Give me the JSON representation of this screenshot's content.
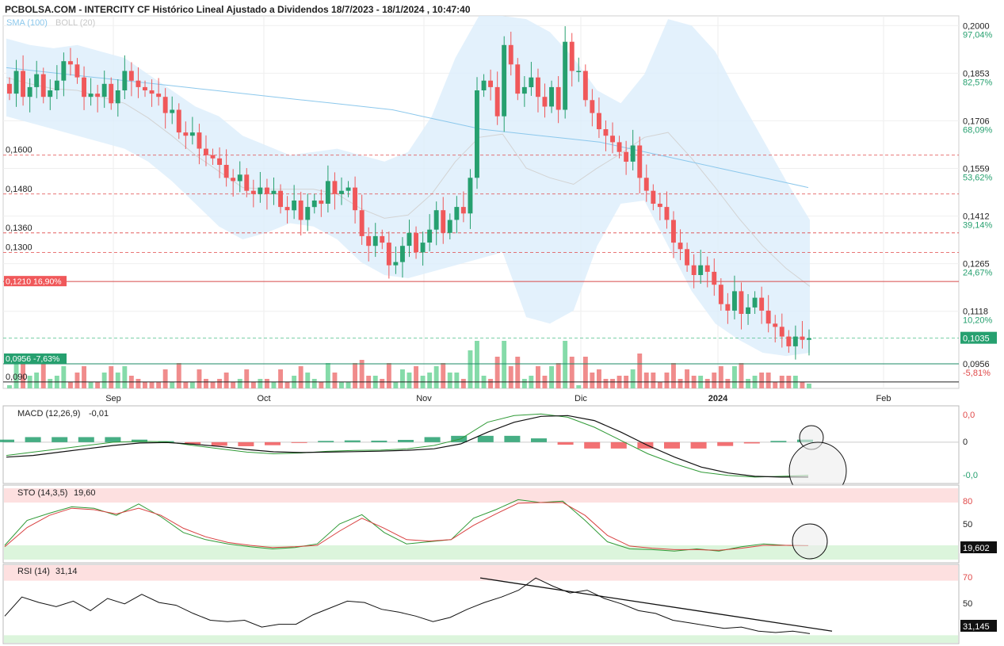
{
  "header": {
    "title": "PCBOLSA.COM - INTERCITY CF Histórico Lineal Ajustado a Dividendos 18/7/2023 - 18/1/2024 , 10:47:40",
    "indicators_sma": "SMA (100)",
    "indicators_boll": "BOLL (20)"
  },
  "colors": {
    "up": "#26a06f",
    "down": "#f0585a",
    "up_vol": "#85dba9",
    "down_vol": "#f08c8c",
    "band_fill": "#dcedfb",
    "sma_line": "#8cc8ec",
    "boll_mid": "#d3d3d3",
    "hline_dash": "#e04848",
    "hline_solid_red": "#d84a4a",
    "hline_green": "#1b8a66",
    "last_price_bg": "#26a06f",
    "red_label_bg": "#f0585a"
  },
  "chart_data": [
    {
      "panel": "price",
      "type": "candlestick",
      "x_tick_labels": [
        "Sep",
        "Oct",
        "Nov",
        "Dic",
        "2024",
        "Feb"
      ],
      "y_ticks": [
        {
          "value": "0,2000",
          "pct": "97,04%"
        },
        {
          "value": "0,1853",
          "pct": "82,57%"
        },
        {
          "value": "0,1706",
          "pct": "68,09%"
        },
        {
          "value": "0,1559",
          "pct": "53,62%"
        },
        {
          "value": "0,1412",
          "pct": "39,14%"
        },
        {
          "value": "0,1265",
          "pct": "24,67%"
        },
        {
          "value": "0,1118",
          "pct": "10,20%"
        },
        {
          "value": "0,0956",
          "pct": "-5,81%"
        }
      ],
      "ylim": [
        0.088,
        0.203
      ],
      "left_labels": [
        {
          "price": 0.16,
          "text": "0,1600"
        },
        {
          "price": 0.148,
          "text": "0,1480"
        },
        {
          "price": 0.136,
          "text": "0,1360"
        },
        {
          "price": 0.13,
          "text": "0,1300"
        },
        {
          "price": 0.09,
          "text": "0,090"
        }
      ],
      "red_label": {
        "price": 0.121,
        "text": "0,1210  16,90%"
      },
      "green_label": {
        "price": 0.0956,
        "text": "0,0956  -7,63%"
      },
      "last_price": {
        "price": 0.1035,
        "text": "0,1035"
      },
      "closes": [
        0.179,
        0.186,
        0.178,
        0.181,
        0.185,
        0.178,
        0.18,
        0.183,
        0.189,
        0.188,
        0.184,
        0.178,
        0.179,
        0.178,
        0.182,
        0.176,
        0.18,
        0.186,
        0.183,
        0.181,
        0.18,
        0.179,
        0.178,
        0.173,
        0.174,
        0.167,
        0.166,
        0.167,
        0.162,
        0.16,
        0.159,
        0.157,
        0.153,
        0.152,
        0.154,
        0.149,
        0.148,
        0.15,
        0.148,
        0.149,
        0.144,
        0.143,
        0.146,
        0.14,
        0.144,
        0.146,
        0.145,
        0.152,
        0.148,
        0.149,
        0.15,
        0.143,
        0.135,
        0.132,
        0.135,
        0.133,
        0.126,
        0.127,
        0.132,
        0.136,
        0.13,
        0.133,
        0.137,
        0.143,
        0.136,
        0.14,
        0.144,
        0.142,
        0.153,
        0.18,
        0.183,
        0.181,
        0.172,
        0.194,
        0.188,
        0.179,
        0.181,
        0.184,
        0.178,
        0.175,
        0.181,
        0.174,
        0.195,
        0.186,
        0.186,
        0.177,
        0.173,
        0.168,
        0.166,
        0.164,
        0.161,
        0.158,
        0.163,
        0.153,
        0.149,
        0.145,
        0.144,
        0.14,
        0.133,
        0.131,
        0.126,
        0.123,
        0.126,
        0.124,
        0.12,
        0.114,
        0.112,
        0.118,
        0.111,
        0.113,
        0.116,
        0.112,
        0.108,
        0.107,
        0.104,
        0.101,
        0.104,
        0.103,
        0.1035
      ],
      "sma_100": [
        0.187,
        0.186,
        0.185,
        0.184,
        0.183,
        0.182,
        0.181,
        0.18,
        0.179,
        0.178,
        0.177,
        0.176,
        0.175,
        0.174,
        0.172,
        0.17,
        0.168,
        0.167,
        0.166,
        0.165,
        0.164,
        0.162,
        0.16,
        0.158,
        0.156,
        0.154,
        0.152,
        0.15
      ],
      "boll_upper": [
        0.196,
        0.194,
        0.193,
        0.194,
        0.192,
        0.19,
        0.185,
        0.18,
        0.175,
        0.172,
        0.166,
        0.163,
        0.16,
        0.161,
        0.162,
        0.16,
        0.158,
        0.161,
        0.172,
        0.19,
        0.203,
        0.203,
        0.202,
        0.198,
        0.19,
        0.18,
        0.176,
        0.185,
        0.202,
        0.2,
        0.192,
        0.178,
        0.165,
        0.152,
        0.14
      ],
      "boll_lower": [
        0.172,
        0.17,
        0.168,
        0.166,
        0.164,
        0.162,
        0.158,
        0.152,
        0.145,
        0.138,
        0.134,
        0.136,
        0.139,
        0.138,
        0.134,
        0.127,
        0.123,
        0.122,
        0.124,
        0.126,
        0.128,
        0.13,
        0.11,
        0.108,
        0.112,
        0.132,
        0.145,
        0.146,
        0.132,
        0.118,
        0.108,
        0.103,
        0.099,
        0.098,
        0.099
      ]
    },
    {
      "panel": "macd",
      "type": "line",
      "label": "MACD (12,26,9)",
      "value": "-0,01",
      "y_ticks": [
        "0,0",
        "0",
        "-0,0"
      ],
      "macd": [
        -0.008,
        -0.006,
        -0.004,
        -0.002,
        0.0,
        0.0005,
        0.0002,
        -0.002,
        -0.004,
        -0.006,
        -0.007,
        -0.0065,
        -0.0055,
        -0.005,
        -0.0048,
        -0.004,
        -0.002,
        0.002,
        0.012,
        0.016,
        0.017,
        0.015,
        0.009,
        0.001,
        -0.007,
        -0.013,
        -0.018,
        -0.02,
        -0.021,
        -0.0205,
        -0.02
      ],
      "signal": [
        -0.009,
        -0.008,
        -0.006,
        -0.004,
        -0.002,
        -0.0005,
        -0.0002,
        -0.0012,
        -0.0026,
        -0.0044,
        -0.0058,
        -0.0062,
        -0.006,
        -0.0057,
        -0.0054,
        -0.0049,
        -0.004,
        -0.001,
        0.006,
        0.012,
        0.0155,
        0.016,
        0.013,
        0.006,
        -0.002,
        -0.009,
        -0.015,
        -0.0185,
        -0.0205,
        -0.021,
        -0.021
      ],
      "ylim": [
        -0.022,
        0.019
      ]
    },
    {
      "panel": "stoch",
      "type": "line",
      "label": "STO (14,3,5)",
      "value": "19,60",
      "last_value": "19,602",
      "y_ticks": [
        "80",
        "50",
        "20"
      ],
      "k": [
        20,
        55,
        65,
        74,
        72,
        62,
        78,
        60,
        38,
        28,
        22,
        18,
        15,
        17,
        22,
        50,
        63,
        38,
        22,
        25,
        28,
        58,
        70,
        84,
        80,
        82,
        55,
        25,
        15,
        14,
        12,
        15,
        12,
        18,
        22,
        20,
        19.6
      ],
      "d": [
        18,
        45,
        62,
        72,
        70,
        64,
        72,
        62,
        44,
        32,
        24,
        20,
        17,
        18,
        20,
        40,
        58,
        44,
        28,
        26,
        28,
        48,
        64,
        79,
        80,
        80,
        62,
        34,
        19,
        16,
        14,
        14,
        13,
        16,
        20,
        20,
        19.6
      ],
      "ylim": [
        0,
        100
      ]
    },
    {
      "panel": "rsi",
      "type": "line",
      "label": "RSI (14)",
      "value": "31,14",
      "last_value": "31,145",
      "y_ticks": [
        "70",
        "50"
      ],
      "rsi": [
        44,
        58,
        54,
        51,
        55,
        48,
        57,
        53,
        60,
        54,
        52,
        46,
        41,
        40,
        41,
        36,
        38,
        38,
        45,
        50,
        55,
        54,
        49,
        47,
        44,
        40,
        43,
        49,
        54,
        58,
        63,
        72,
        66,
        61,
        63,
        57,
        53,
        48,
        46,
        41,
        39,
        37,
        35,
        36,
        33,
        32,
        33,
        31.14
      ],
      "ylim": [
        25,
        75
      ]
    }
  ]
}
